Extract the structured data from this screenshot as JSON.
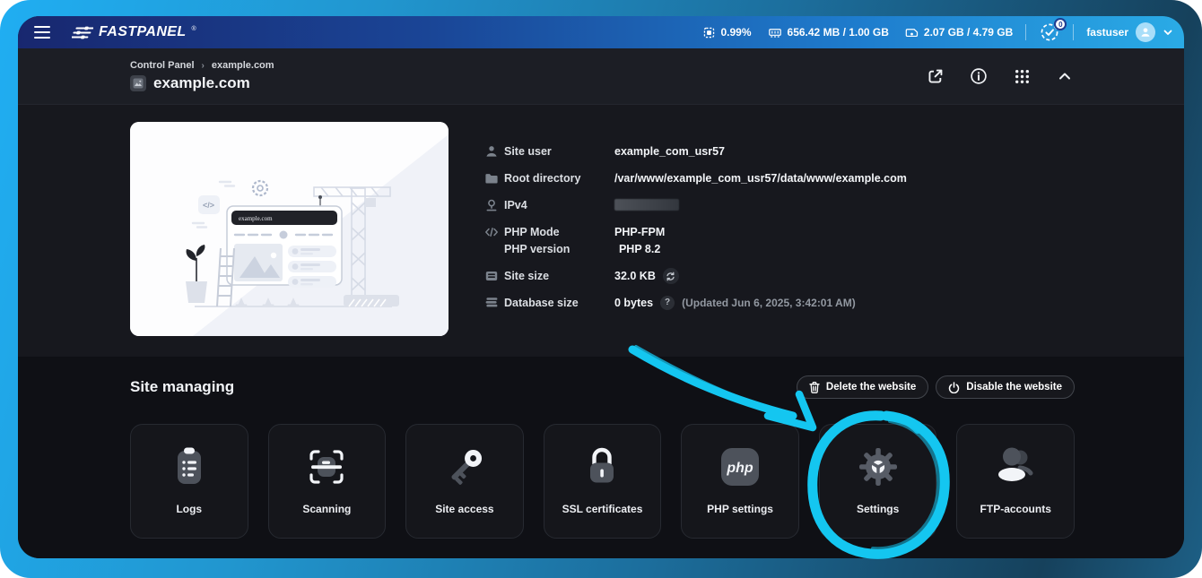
{
  "topbar": {
    "brand": "FASTPANEL",
    "brand_reg": "®",
    "stats": {
      "cpu": "0.99%",
      "ram": "656.42 MB / 1.00 GB",
      "disk": "2.07 GB / 4.79 GB"
    },
    "notifications_count": "0",
    "user": "fastuser"
  },
  "header": {
    "breadcrumb": [
      "Control Panel",
      "example.com"
    ],
    "breadcrumb_separator": "›",
    "title": "example.com"
  },
  "site_info": {
    "illustration_domain": "example.com",
    "rows": [
      {
        "label": "Site user",
        "value": "example_com_usr57"
      },
      {
        "label": "Root directory",
        "value": "/var/www/example_com_usr57/data/www/example.com"
      },
      {
        "label": "IPv4",
        "value_redacted": true
      },
      {
        "labels": [
          "PHP Mode",
          "PHP version"
        ],
        "values": [
          "PHP-FPM",
          "PHP 8.2"
        ]
      },
      {
        "label": "Site size",
        "value": "32.0 KB"
      },
      {
        "label": "Database size",
        "value": "0 bytes",
        "help": "?",
        "note": "(Updated Jun 6, 2025, 3:42:01 AM)"
      }
    ]
  },
  "managing": {
    "heading": "Site managing",
    "actions": [
      {
        "icon": "trash-icon",
        "label": "Delete the website"
      },
      {
        "icon": "power-icon",
        "label": "Disable the website"
      }
    ],
    "cards": [
      {
        "icon": "logs-icon",
        "label": "Logs"
      },
      {
        "icon": "scan-icon",
        "label": "Scanning"
      },
      {
        "icon": "key-icon",
        "label": "Site access"
      },
      {
        "icon": "lock-icon",
        "label": "SSL certificates"
      },
      {
        "icon": "php-icon",
        "label": "PHP settings",
        "php_text": "php"
      },
      {
        "icon": "gear-icon",
        "label": "Settings"
      },
      {
        "icon": "users-icon",
        "label": "FTP-accounts"
      }
    ]
  },
  "annotation": {
    "highlight_target": "Settings",
    "accent_color": "#14c6f0"
  },
  "colors": {
    "frame_gradient_start": "#20aef2",
    "frame_gradient_end": "#1d5f85",
    "navbar_gradient_start": "#18276f",
    "navbar_gradient_end": "#2aabe6",
    "page_background": "#16171d",
    "section_background": "#0f1015",
    "card_background": "#15161b"
  }
}
